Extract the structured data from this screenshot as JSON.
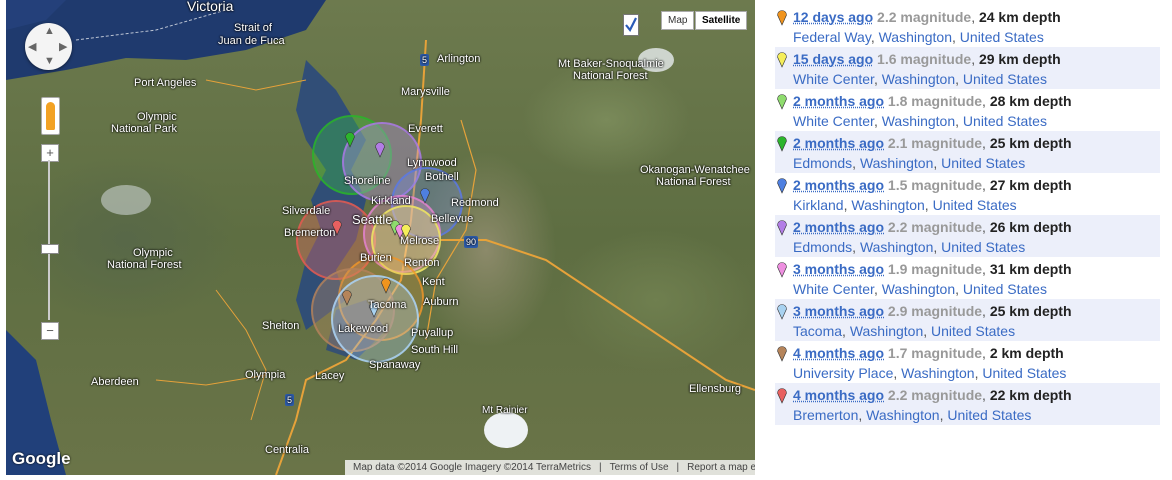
{
  "map": {
    "labels": {
      "victoria": "Victoria",
      "strait": "Strait of",
      "juan": "Juan de Fuca",
      "arlington": "Arlington",
      "marysville": "Marysville",
      "mtbaker1": "Mt Baker-Snoqualmie",
      "mtbaker2": "National Forest",
      "portangeles": "Port Angeles",
      "olympic1": "Olympic",
      "olympic2": "National Park",
      "everett": "Everett",
      "lynnwood": "Lynnwood",
      "bothell": "Bothell",
      "shoreline": "Shoreline",
      "redmond": "Redmond",
      "kirkland": "Kirkland",
      "bellevue": "Bellevue",
      "seattle": "Seattle",
      "silverdale": "Silverdale",
      "bremerton": "Bremerton",
      "melrose": "Melrose",
      "olynf1": "Olympic",
      "olynf2": "National Forest",
      "burien": "Burien",
      "renton": "Renton",
      "kent": "Kent",
      "tacoma": "Tacoma",
      "auburn": "Auburn",
      "lakewood": "Lakewood",
      "puyallup": "Puyallup",
      "shelton": "Shelton",
      "southhill": "South Hill",
      "spanaway": "Spanaway",
      "aberdeen": "Aberdeen",
      "olympia": "Olympia",
      "lacey": "Lacey",
      "okanogan1": "Okanogan-Wenatchee",
      "okanogan2": "National Forest",
      "ellensburg": "Ellensburg",
      "mtrainier": "Mt Rainier",
      "centralia": "Centralia",
      "hwy5a": "5",
      "hwy5b": "5",
      "hwy90": "90"
    },
    "controls": {
      "map_btn": "Map",
      "satellite_btn": "Satellite",
      "zoom_in": "+",
      "zoom_out": "−",
      "google": "Google",
      "attribution": "Map data ©2014 Google Imagery ©2014 TerraMetrics",
      "terms": "Terms of Use",
      "report": "Report a map error"
    }
  },
  "quakes": [
    {
      "when": "12 days ago",
      "mag": "2.2 magnitude",
      "depth": "24 km depth",
      "city": "Federal Way",
      "state": "Washington",
      "country": "United States",
      "color": "#f0941e"
    },
    {
      "when": "15 days ago",
      "mag": "1.6 magnitude",
      "depth": "29 km depth",
      "city": "White Center",
      "state": "Washington",
      "country": "United States",
      "color": "#f5ee5a"
    },
    {
      "when": "2 months ago",
      "mag": "1.8 magnitude",
      "depth": "28 km depth",
      "city": "White Center",
      "state": "Washington",
      "country": "United States",
      "color": "#8fdc6e"
    },
    {
      "when": "2 months ago",
      "mag": "2.1 magnitude",
      "depth": "25 km depth",
      "city": "Edmonds",
      "state": "Washington",
      "country": "United States",
      "color": "#2cb52c"
    },
    {
      "when": "2 months ago",
      "mag": "1.5 magnitude",
      "depth": "27 km depth",
      "city": "Kirkland",
      "state": "Washington",
      "country": "United States",
      "color": "#4e7fe0"
    },
    {
      "when": "2 months ago",
      "mag": "2.2 magnitude",
      "depth": "26 km depth",
      "city": "Edmonds",
      "state": "Washington",
      "country": "United States",
      "color": "#b27de6"
    },
    {
      "when": "3 months ago",
      "mag": "1.9 magnitude",
      "depth": "31 km depth",
      "city": "White Center",
      "state": "Washington",
      "country": "United States",
      "color": "#ee8fe0"
    },
    {
      "when": "3 months ago",
      "mag": "2.9 magnitude",
      "depth": "25 km depth",
      "city": "Tacoma",
      "state": "Washington",
      "country": "United States",
      "color": "#a9d2f0"
    },
    {
      "when": "4 months ago",
      "mag": "1.7 magnitude",
      "depth": "2 km depth",
      "city": "University Place",
      "state": "Washington",
      "country": "United States",
      "color": "#b5845a"
    },
    {
      "when": "4 months ago",
      "mag": "2.2 magnitude",
      "depth": "22 km depth",
      "city": "Bremerton",
      "state": "Washington",
      "country": "United States",
      "color": "#e86060"
    }
  ]
}
